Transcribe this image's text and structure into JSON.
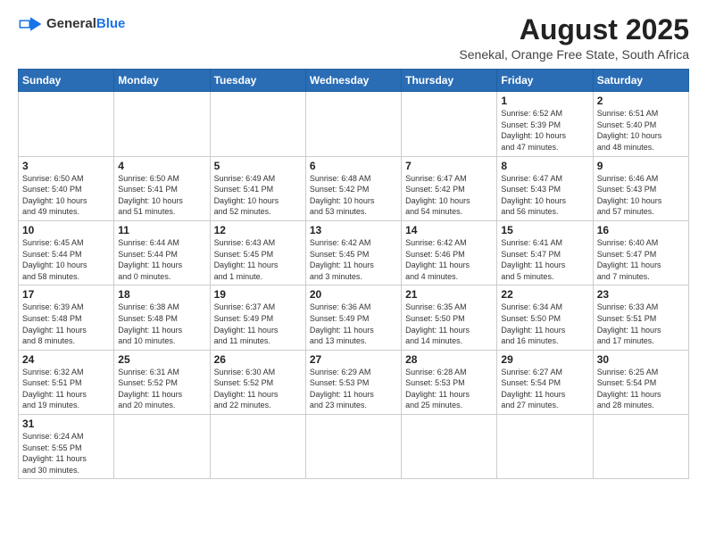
{
  "header": {
    "logo_general": "General",
    "logo_blue": "Blue",
    "title": "August 2025",
    "subtitle": "Senekal, Orange Free State, South Africa"
  },
  "days_of_week": [
    "Sunday",
    "Monday",
    "Tuesday",
    "Wednesday",
    "Thursday",
    "Friday",
    "Saturday"
  ],
  "weeks": [
    [
      {
        "day": "",
        "info": ""
      },
      {
        "day": "",
        "info": ""
      },
      {
        "day": "",
        "info": ""
      },
      {
        "day": "",
        "info": ""
      },
      {
        "day": "",
        "info": ""
      },
      {
        "day": "1",
        "info": "Sunrise: 6:52 AM\nSunset: 5:39 PM\nDaylight: 10 hours\nand 47 minutes."
      },
      {
        "day": "2",
        "info": "Sunrise: 6:51 AM\nSunset: 5:40 PM\nDaylight: 10 hours\nand 48 minutes."
      }
    ],
    [
      {
        "day": "3",
        "info": "Sunrise: 6:50 AM\nSunset: 5:40 PM\nDaylight: 10 hours\nand 49 minutes."
      },
      {
        "day": "4",
        "info": "Sunrise: 6:50 AM\nSunset: 5:41 PM\nDaylight: 10 hours\nand 51 minutes."
      },
      {
        "day": "5",
        "info": "Sunrise: 6:49 AM\nSunset: 5:41 PM\nDaylight: 10 hours\nand 52 minutes."
      },
      {
        "day": "6",
        "info": "Sunrise: 6:48 AM\nSunset: 5:42 PM\nDaylight: 10 hours\nand 53 minutes."
      },
      {
        "day": "7",
        "info": "Sunrise: 6:47 AM\nSunset: 5:42 PM\nDaylight: 10 hours\nand 54 minutes."
      },
      {
        "day": "8",
        "info": "Sunrise: 6:47 AM\nSunset: 5:43 PM\nDaylight: 10 hours\nand 56 minutes."
      },
      {
        "day": "9",
        "info": "Sunrise: 6:46 AM\nSunset: 5:43 PM\nDaylight: 10 hours\nand 57 minutes."
      }
    ],
    [
      {
        "day": "10",
        "info": "Sunrise: 6:45 AM\nSunset: 5:44 PM\nDaylight: 10 hours\nand 58 minutes."
      },
      {
        "day": "11",
        "info": "Sunrise: 6:44 AM\nSunset: 5:44 PM\nDaylight: 11 hours\nand 0 minutes."
      },
      {
        "day": "12",
        "info": "Sunrise: 6:43 AM\nSunset: 5:45 PM\nDaylight: 11 hours\nand 1 minute."
      },
      {
        "day": "13",
        "info": "Sunrise: 6:42 AM\nSunset: 5:45 PM\nDaylight: 11 hours\nand 3 minutes."
      },
      {
        "day": "14",
        "info": "Sunrise: 6:42 AM\nSunset: 5:46 PM\nDaylight: 11 hours\nand 4 minutes."
      },
      {
        "day": "15",
        "info": "Sunrise: 6:41 AM\nSunset: 5:47 PM\nDaylight: 11 hours\nand 5 minutes."
      },
      {
        "day": "16",
        "info": "Sunrise: 6:40 AM\nSunset: 5:47 PM\nDaylight: 11 hours\nand 7 minutes."
      }
    ],
    [
      {
        "day": "17",
        "info": "Sunrise: 6:39 AM\nSunset: 5:48 PM\nDaylight: 11 hours\nand 8 minutes."
      },
      {
        "day": "18",
        "info": "Sunrise: 6:38 AM\nSunset: 5:48 PM\nDaylight: 11 hours\nand 10 minutes."
      },
      {
        "day": "19",
        "info": "Sunrise: 6:37 AM\nSunset: 5:49 PM\nDaylight: 11 hours\nand 11 minutes."
      },
      {
        "day": "20",
        "info": "Sunrise: 6:36 AM\nSunset: 5:49 PM\nDaylight: 11 hours\nand 13 minutes."
      },
      {
        "day": "21",
        "info": "Sunrise: 6:35 AM\nSunset: 5:50 PM\nDaylight: 11 hours\nand 14 minutes."
      },
      {
        "day": "22",
        "info": "Sunrise: 6:34 AM\nSunset: 5:50 PM\nDaylight: 11 hours\nand 16 minutes."
      },
      {
        "day": "23",
        "info": "Sunrise: 6:33 AM\nSunset: 5:51 PM\nDaylight: 11 hours\nand 17 minutes."
      }
    ],
    [
      {
        "day": "24",
        "info": "Sunrise: 6:32 AM\nSunset: 5:51 PM\nDaylight: 11 hours\nand 19 minutes."
      },
      {
        "day": "25",
        "info": "Sunrise: 6:31 AM\nSunset: 5:52 PM\nDaylight: 11 hours\nand 20 minutes."
      },
      {
        "day": "26",
        "info": "Sunrise: 6:30 AM\nSunset: 5:52 PM\nDaylight: 11 hours\nand 22 minutes."
      },
      {
        "day": "27",
        "info": "Sunrise: 6:29 AM\nSunset: 5:53 PM\nDaylight: 11 hours\nand 23 minutes."
      },
      {
        "day": "28",
        "info": "Sunrise: 6:28 AM\nSunset: 5:53 PM\nDaylight: 11 hours\nand 25 minutes."
      },
      {
        "day": "29",
        "info": "Sunrise: 6:27 AM\nSunset: 5:54 PM\nDaylight: 11 hours\nand 27 minutes."
      },
      {
        "day": "30",
        "info": "Sunrise: 6:25 AM\nSunset: 5:54 PM\nDaylight: 11 hours\nand 28 minutes."
      }
    ],
    [
      {
        "day": "31",
        "info": "Sunrise: 6:24 AM\nSunset: 5:55 PM\nDaylight: 11 hours\nand 30 minutes."
      },
      {
        "day": "",
        "info": ""
      },
      {
        "day": "",
        "info": ""
      },
      {
        "day": "",
        "info": ""
      },
      {
        "day": "",
        "info": ""
      },
      {
        "day": "",
        "info": ""
      },
      {
        "day": "",
        "info": ""
      }
    ]
  ]
}
